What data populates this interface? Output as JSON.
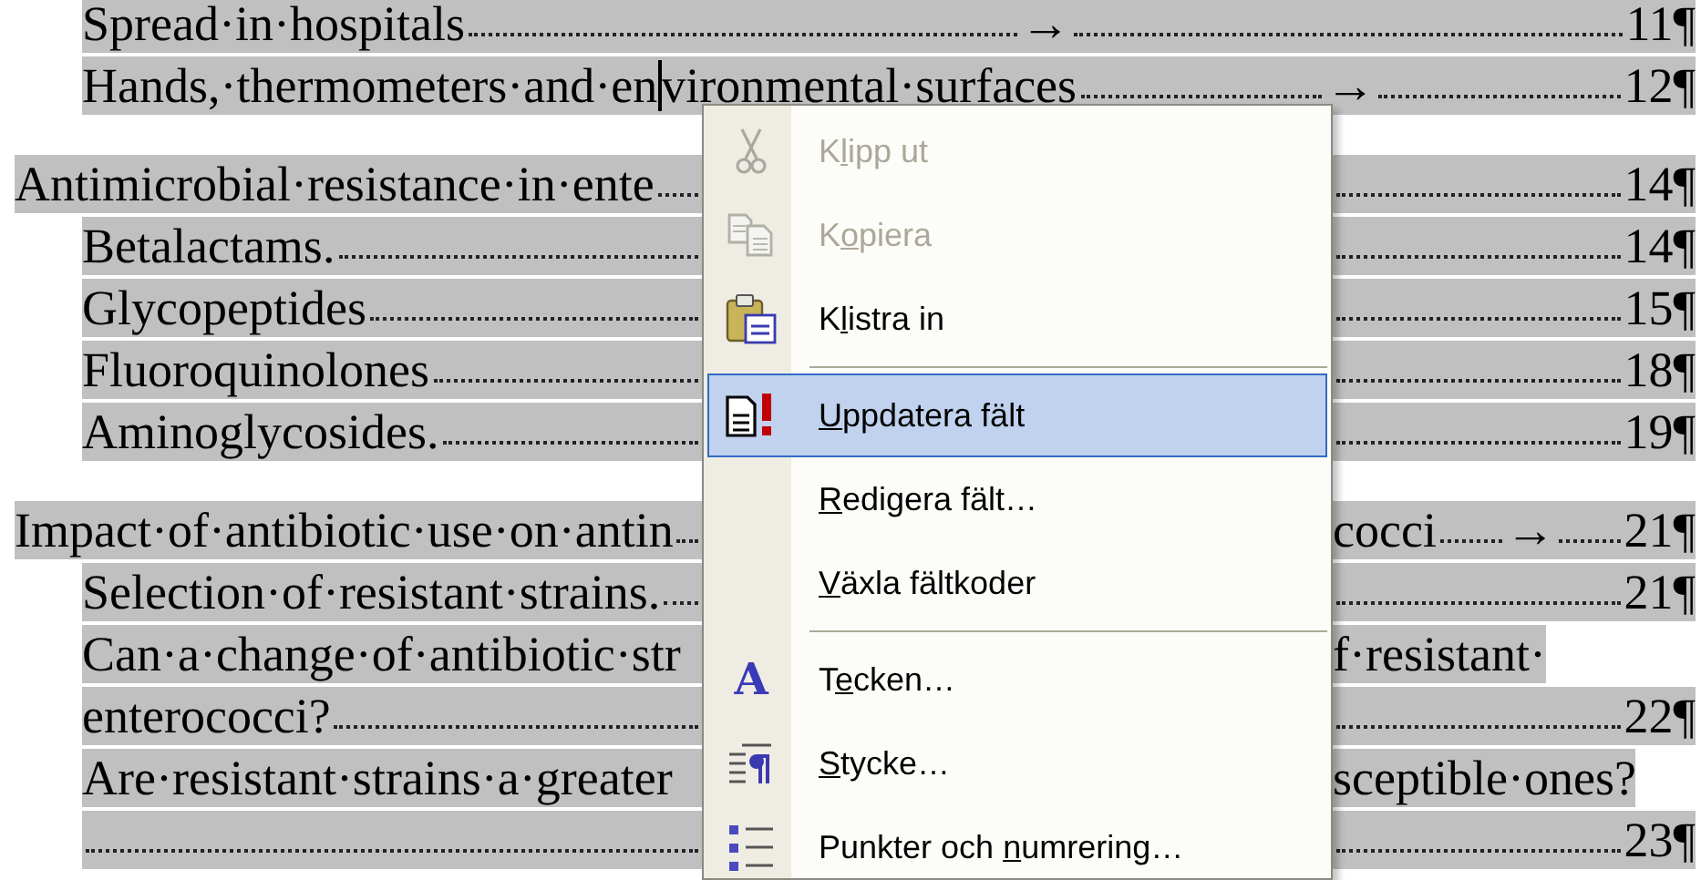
{
  "toc": {
    "continued": [
      {
        "lines": [
          {
            "kind": "full",
            "text": "Spread·in·hospitals",
            "tab_mark": "→",
            "page": "11¶"
          }
        ]
      },
      {
        "lines": [
          {
            "kind": "full",
            "text": "Hands,·thermometers·and·en",
            "cursor": true,
            "text_after_cursor": "vironmental·surfaces",
            "tab_mark": "→",
            "page": "12¶"
          }
        ]
      }
    ],
    "sections": [
      {
        "lines": [
          {
            "kind": "split",
            "text": "Antimicrobial·resistance·in·ente",
            "page": "14¶"
          }
        ],
        "children": [
          {
            "lines": [
              {
                "kind": "split",
                "text": "Betalactams.",
                "page": "14¶"
              }
            ]
          },
          {
            "lines": [
              {
                "kind": "split",
                "text": "Glycopeptides",
                "page": "15¶"
              }
            ]
          },
          {
            "lines": [
              {
                "kind": "split",
                "text": "Fluoroquinolones",
                "page": "18¶"
              }
            ]
          },
          {
            "lines": [
              {
                "kind": "split",
                "text": "Aminoglycosides.",
                "page": "19¶"
              }
            ]
          }
        ]
      },
      {
        "lines": [
          {
            "kind": "split",
            "text": "Impact·of·antibiotic·use·on·antin",
            "after_menu": "cocci",
            "tab_mark": "→",
            "page": "21¶"
          }
        ],
        "children": [
          {
            "lines": [
              {
                "kind": "split",
                "text": "Selection·of·resistant·strains.",
                "page": "21¶"
              }
            ]
          },
          {
            "lines": [
              {
                "kind": "split",
                "text": "Can·a·change·of·antibiotic·str",
                "after_menu": "f·resistant·"
              },
              {
                "kind": "split",
                "text": "enterococci?",
                "page": "22¶"
              }
            ]
          },
          {
            "lines": [
              {
                "kind": "split",
                "text": "Are·resistant·strains·a·greater",
                "after_menu": "sceptible·ones?"
              },
              {
                "kind": "split",
                "page": "23¶"
              }
            ]
          }
        ]
      }
    ]
  },
  "context_menu": [
    {
      "kind": "item",
      "pre": "K",
      "key": "l",
      "post": "ipp ut",
      "disabled": true,
      "selected": false
    },
    {
      "kind": "item",
      "pre": "K",
      "key": "o",
      "post": "piera",
      "disabled": true,
      "selected": false
    },
    {
      "kind": "item",
      "pre": "K",
      "key": "l",
      "post": "istra in",
      "disabled": false,
      "selected": false
    },
    {
      "kind": "separator"
    },
    {
      "kind": "item",
      "key": "U",
      "post": "ppdatera fält",
      "disabled": false,
      "selected": true
    },
    {
      "kind": "item",
      "key": "R",
      "post": "edigera fält…",
      "disabled": false,
      "selected": false
    },
    {
      "kind": "item",
      "key": "V",
      "post": "äxla fältkoder",
      "disabled": false,
      "selected": false
    },
    {
      "kind": "separator"
    },
    {
      "kind": "item",
      "glyph": "A",
      "pre": "T",
      "key": "e",
      "post": "cken…",
      "disabled": false,
      "selected": false
    },
    {
      "kind": "item",
      "key": "S",
      "post": "tycke…",
      "disabled": false,
      "selected": false
    },
    {
      "kind": "item",
      "pre": "Punkter och ",
      "key": "n",
      "post": "umrering…",
      "disabled": false,
      "selected": false
    }
  ]
}
